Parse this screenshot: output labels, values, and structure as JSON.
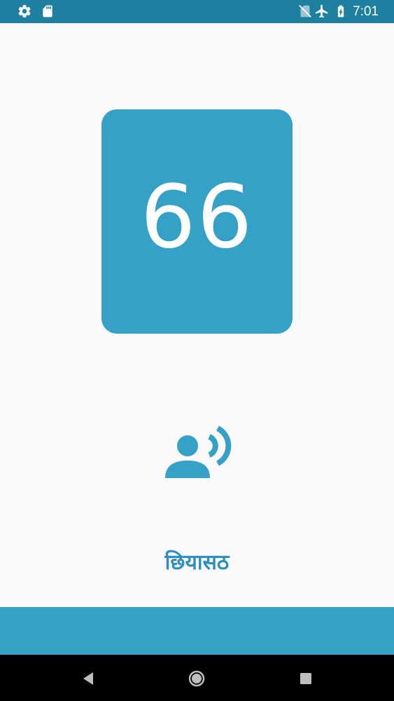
{
  "status_bar": {
    "time": "7:01",
    "background_color": "#1f7fa1",
    "left_icons": [
      "gear-icon",
      "sd-card-icon"
    ],
    "right_icons": [
      "no-sim-icon",
      "airplane-mode-icon",
      "battery-charging-icon"
    ]
  },
  "main": {
    "number": "66",
    "word": "छियासठ",
    "speak_icon": "record-voice-icon",
    "accent_color": "#35a1c7",
    "word_color": "#2f8fbd"
  },
  "nav_bar": {
    "buttons": [
      "back-icon",
      "home-icon",
      "recents-icon"
    ]
  }
}
